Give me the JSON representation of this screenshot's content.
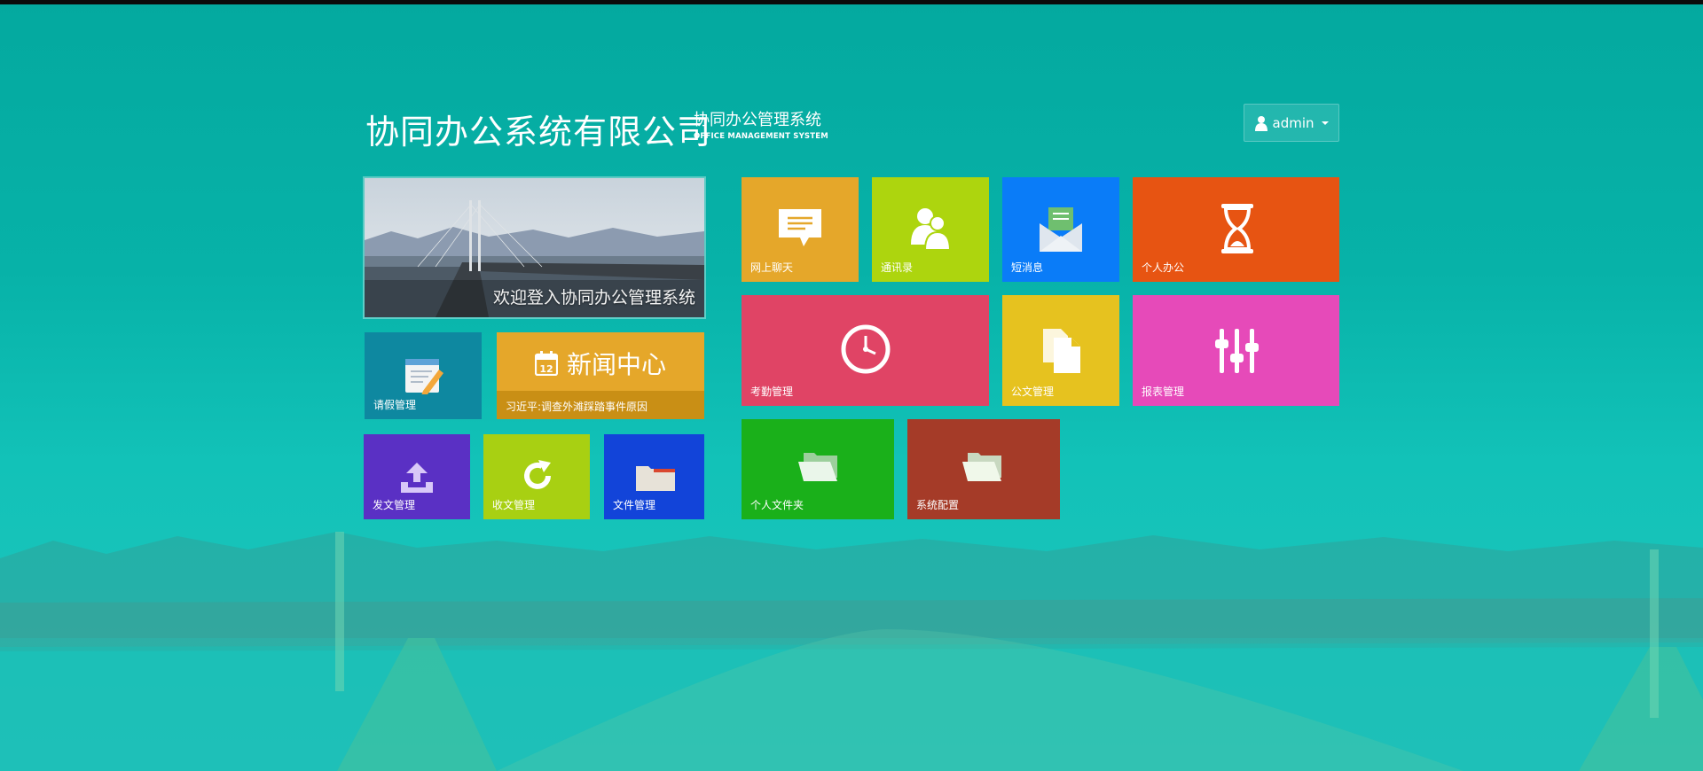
{
  "header": {
    "title": "协同办公系统有限公司",
    "subtitle_cn": "协同办公管理系统",
    "subtitle_en": "OFFICE MANAGEMENT SYSTEM"
  },
  "user": {
    "name": "admin",
    "icon": "user-icon"
  },
  "banner": {
    "caption": "欢迎登入协同办公管理系统"
  },
  "news": {
    "title": "新闻中心",
    "headline": "习近平:调查外滩踩踏事件原因",
    "icon": "calendar-icon"
  },
  "tiles": {
    "leave": {
      "label": "请假管理",
      "icon": "notepad-pencil-icon",
      "color": "#0e88a0"
    },
    "send_doc": {
      "label": "发文管理",
      "icon": "upload-icon",
      "color": "#5a30c4"
    },
    "receive_doc": {
      "label": "收文管理",
      "icon": "refresh-icon",
      "color": "#a8d012"
    },
    "file_mgmt": {
      "label": "文件管理",
      "icon": "folder-icon",
      "color": "#1244d9"
    },
    "chat": {
      "label": "网上聊天",
      "icon": "chat-bubble-icon",
      "color": "#e5a72a"
    },
    "contacts": {
      "label": "通讯录",
      "icon": "users-icon",
      "color": "#add50e"
    },
    "messages": {
      "label": "短消息",
      "icon": "envelope-icon",
      "color": "#0a7cf8"
    },
    "personal_office": {
      "label": "个人办公",
      "icon": "hourglass-icon",
      "color": "#e75412"
    },
    "attendance": {
      "label": "考勤管理",
      "icon": "clock-icon",
      "color": "#e04465"
    },
    "official_doc": {
      "label": "公文管理",
      "icon": "documents-icon",
      "color": "#e6c21f"
    },
    "reports": {
      "label": "报表管理",
      "icon": "sliders-icon",
      "color": "#e64ab9"
    },
    "personal_folder": {
      "label": "个人文件夹",
      "icon": "open-folder-icon",
      "color": "#1ab01a"
    },
    "system_config": {
      "label": "系统配置",
      "icon": "open-folder-icon",
      "color": "#a53b28"
    }
  }
}
